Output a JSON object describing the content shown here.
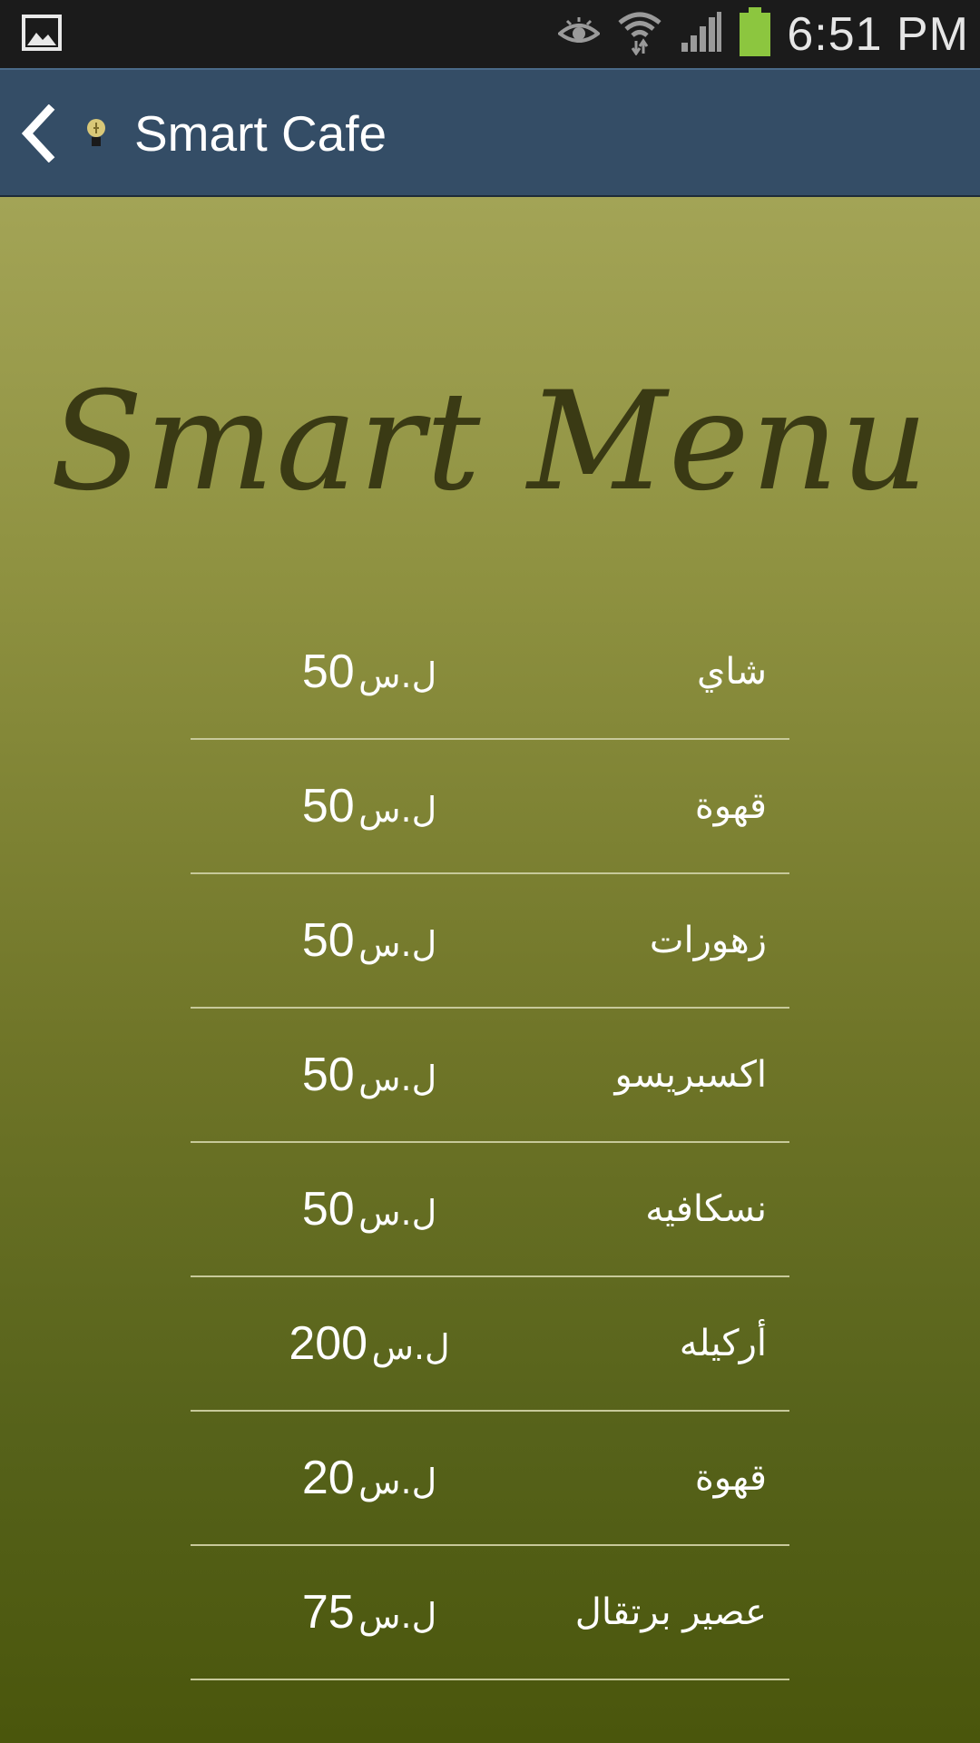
{
  "status_bar": {
    "time": "6:51 PM",
    "icons": [
      "gallery-icon",
      "eye-icon",
      "wifi-icon",
      "signal-icon",
      "battery-icon"
    ]
  },
  "action_bar": {
    "title": "Smart Cafe",
    "up_icon": "chevron-left-icon",
    "logo_icon": "lightbulb-icon",
    "background": "#344d66"
  },
  "hero": {
    "title": "Smart Menu"
  },
  "menu": {
    "items": [
      {
        "name": "شاي",
        "price": "50",
        "currency": "ل.س"
      },
      {
        "name": "قهوة",
        "price": "50",
        "currency": "ل.س"
      },
      {
        "name": "زهورات",
        "price": "50",
        "currency": "ل.س"
      },
      {
        "name": "اكسبريسو",
        "price": "50",
        "currency": "ل.س"
      },
      {
        "name": "نسكافيه",
        "price": "50",
        "currency": "ل.س"
      },
      {
        "name": "أركيله",
        "price": "200",
        "currency": "ل.س"
      },
      {
        "name": "قهوة",
        "price": "20",
        "currency": "ل.س"
      },
      {
        "name": "عصير برتقال",
        "price": "75",
        "currency": "ل.س"
      }
    ]
  }
}
